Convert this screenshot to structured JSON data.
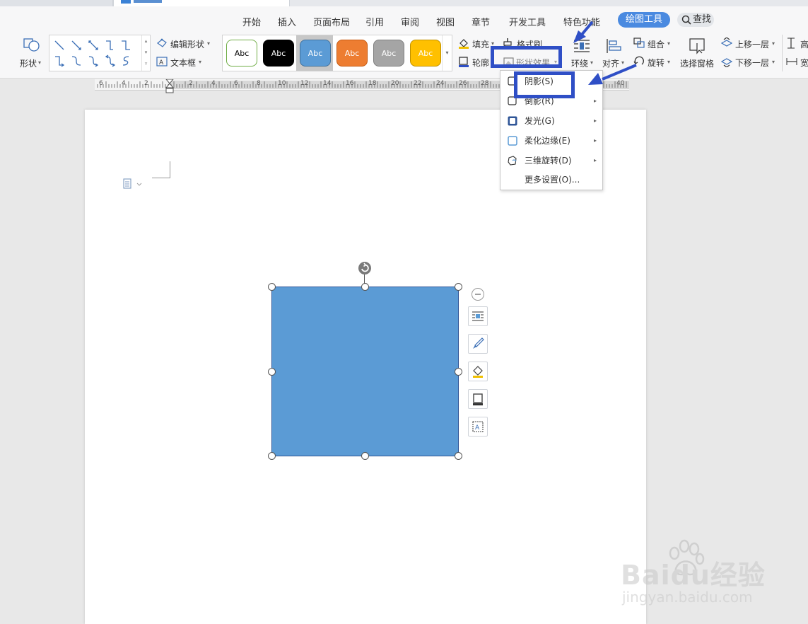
{
  "menu": {
    "items": [
      "开始",
      "插入",
      "页面布局",
      "引用",
      "审阅",
      "视图",
      "章节",
      "开发工具",
      "特色功能"
    ],
    "active": "绘图工具",
    "search": "查找"
  },
  "toolbar": {
    "shape_label": "形状",
    "edit_shape": "编辑形状",
    "text_box": "文本框",
    "style_text": "Abc",
    "fill": "填充",
    "format_painter": "格式刷",
    "outline": "轮廓",
    "shape_effects": "形状效果",
    "wrap": "环绕",
    "align": "对齐",
    "group": "组合",
    "rotate": "旋转",
    "selection_pane": "选择窗格",
    "bring_forward": "上移一层",
    "send_backward": "下移一层",
    "height_label": "高",
    "width_label": "宽"
  },
  "ruler": {
    "numbers": [
      "6",
      "4",
      "2",
      "2",
      "4",
      "6",
      "8",
      "10",
      "12",
      "14",
      "16",
      "18",
      "20",
      "22",
      "24",
      "26",
      "28",
      "40"
    ]
  },
  "dropdown": {
    "items": [
      {
        "label": "阴影(S)",
        "icon": "shadow-icon",
        "submenu": false
      },
      {
        "label": "倒影(R)",
        "icon": "reflection-icon",
        "submenu": true
      },
      {
        "label": "发光(G)",
        "icon": "glow-icon",
        "submenu": true
      },
      {
        "label": "柔化边缘(E)",
        "icon": "soft-edges-icon",
        "submenu": true
      },
      {
        "label": "三维旋转(D)",
        "icon": "3d-rotation-icon",
        "submenu": true
      },
      {
        "label": "更多设置(O)...",
        "icon": "",
        "submenu": false
      }
    ]
  },
  "shape": {
    "fill_color": "#5b9bd5",
    "border_color": "#2f5597"
  },
  "styles": {
    "swatches": [
      {
        "bg": "#ffffff",
        "fg": "#000000",
        "border": "#70ad47"
      },
      {
        "bg": "#000000",
        "fg": "#ffffff",
        "border": "#000000"
      },
      {
        "bg": "#5b9bd5",
        "fg": "#ffffff",
        "border": "#41719c"
      },
      {
        "bg": "#ed7d31",
        "fg": "#ffffff",
        "border": "#c55a11"
      },
      {
        "bg": "#a5a5a5",
        "fg": "#ffffff",
        "border": "#7f7f7f"
      },
      {
        "bg": "#ffc000",
        "fg": "#ffffff",
        "border": "#bf9000"
      }
    ]
  },
  "watermark": {
    "brand": "Baidu经验",
    "url": "jingyan.baidu.com"
  },
  "colors": {
    "highlight": "#2f4fc6",
    "accent": "#4a8ae0"
  }
}
